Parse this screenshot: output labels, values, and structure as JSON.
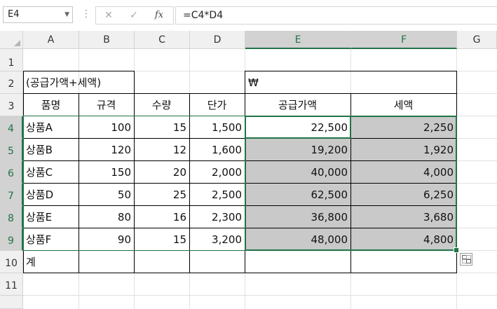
{
  "formula_bar": {
    "name_box": "E4",
    "cancel_icon": "✕",
    "enter_icon": "✓",
    "fx_label": "fx",
    "formula": "=C4*D4"
  },
  "columns": [
    "A",
    "B",
    "C",
    "D",
    "E",
    "F",
    "G"
  ],
  "rows": [
    "1",
    "2",
    "3",
    "4",
    "5",
    "6",
    "7",
    "8",
    "9",
    "10",
    "11"
  ],
  "sheet": {
    "a2": "(공급가액+세액)",
    "e2": "₩",
    "headers": [
      "품명",
      "규격",
      "수량",
      "단가",
      "공급가액",
      "세액"
    ],
    "data": [
      {
        "name": "상품A",
        "spec": "100",
        "qty": "15",
        "price": "1,500",
        "supply": "22,500",
        "tax": "2,250"
      },
      {
        "name": "상품B",
        "spec": "120",
        "qty": "12",
        "price": "1,600",
        "supply": "19,200",
        "tax": "1,920"
      },
      {
        "name": "상품C",
        "spec": "150",
        "qty": "20",
        "price": "2,000",
        "supply": "40,000",
        "tax": "4,000"
      },
      {
        "name": "상품D",
        "spec": "50",
        "qty": "25",
        "price": "2,500",
        "supply": "62,500",
        "tax": "6,250"
      },
      {
        "name": "상품E",
        "spec": "80",
        "qty": "16",
        "price": "2,300",
        "supply": "36,800",
        "tax": "3,680"
      },
      {
        "name": "상품F",
        "spec": "90",
        "qty": "15",
        "price": "3,200",
        "supply": "48,000",
        "tax": "4,800"
      }
    ],
    "total_label": "계"
  },
  "colors": {
    "selection": "#217346",
    "shade": "#c9c9c9",
    "header_bg": "#f0f0f0"
  }
}
